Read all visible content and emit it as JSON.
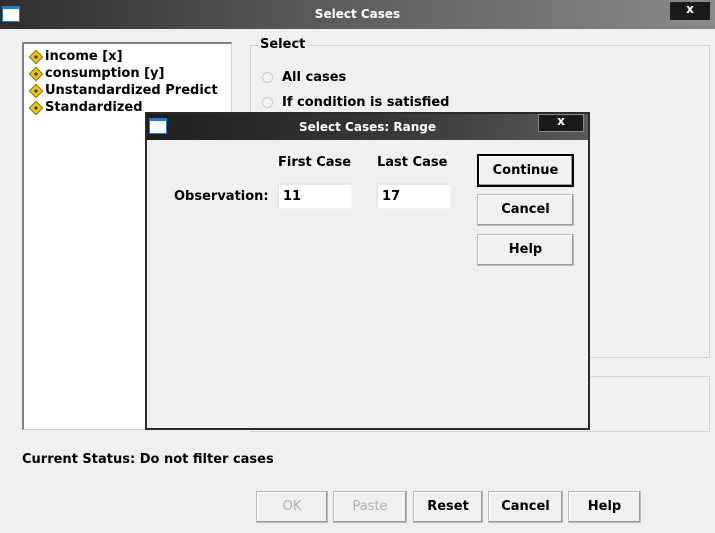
{
  "window": {
    "title": "Select Cases",
    "close_glyph": "x"
  },
  "variables": [
    {
      "label": "income [x]",
      "icon": "scale-variable-icon"
    },
    {
      "label": "consumption [y]",
      "icon": "scale-variable-icon"
    },
    {
      "label": "Unstandardized Predict",
      "icon": "scale-variable-icon"
    },
    {
      "label": "Standardized",
      "icon": "scale-variable-icon"
    }
  ],
  "select_group": {
    "legend": "Select",
    "options": [
      {
        "label": "All cases",
        "selected": false
      },
      {
        "label": "If condition is satisfied",
        "selected": false
      }
    ]
  },
  "status": {
    "text": "Current Status: Do not filter cases"
  },
  "buttons": {
    "ok": "OK",
    "paste": "Paste",
    "reset": "Reset",
    "cancel": "Cancel",
    "help": "Help"
  },
  "range_dialog": {
    "title": "Select Cases: Range",
    "close_glyph": "x",
    "first_case_header": "First Case",
    "last_case_header": "Last Case",
    "row_label": "Observation:",
    "first_case_value": "11",
    "last_case_value": "17",
    "buttons": {
      "continue": "Continue",
      "cancel": "Cancel",
      "help": "Help"
    }
  },
  "colors": {
    "titlebar_dark": "#2e2e2e",
    "icon_accent": "#1f7bd6",
    "variable_icon": "#f7c600",
    "dialog_bg": "#f0f0f0"
  }
}
